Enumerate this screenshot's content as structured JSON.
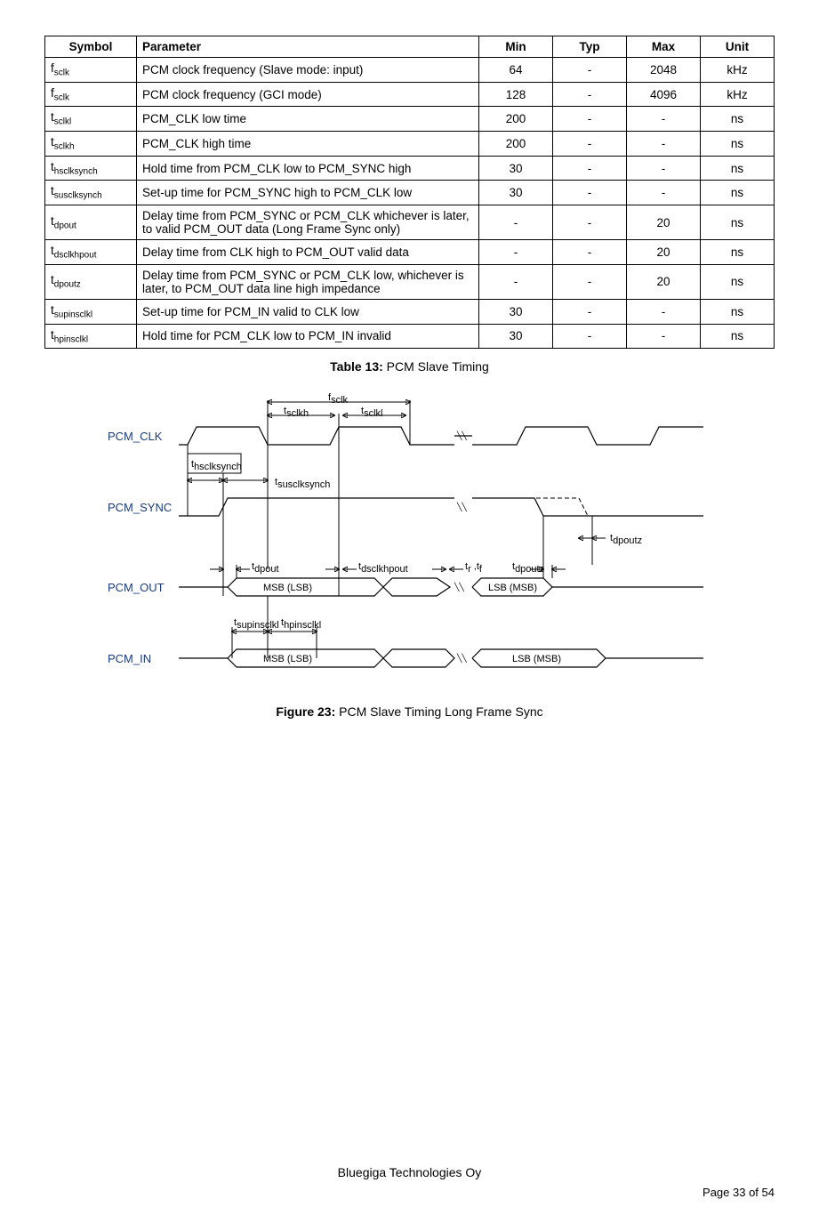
{
  "table": {
    "headers": [
      "Symbol",
      "Parameter",
      "Min",
      "Typ",
      "Max",
      "Unit"
    ],
    "caption_bold": "Table 13:",
    "caption_rest": " PCM Slave Timing",
    "rows": [
      {
        "sym_base": "f",
        "sym_sub": "sclk",
        "param": "PCM clock frequency (Slave mode: input)",
        "min": "64",
        "typ": "-",
        "max": "2048",
        "unit": "kHz"
      },
      {
        "sym_base": "f",
        "sym_sub": "sclk",
        "param": "PCM clock frequency (GCI mode)",
        "min": "128",
        "typ": "-",
        "max": "4096",
        "unit": "kHz"
      },
      {
        "sym_base": "t",
        "sym_sub": "sclkl",
        "param": "PCM_CLK low time",
        "min": "200",
        "typ": "-",
        "max": "-",
        "unit": "ns"
      },
      {
        "sym_base": "t",
        "sym_sub": "sclkh",
        "param": "PCM_CLK high time",
        "min": "200",
        "typ": "-",
        "max": "-",
        "unit": "ns"
      },
      {
        "sym_base": "t",
        "sym_sub": "hsclksynch",
        "param": "Hold time from PCM_CLK low to PCM_SYNC high",
        "min": "30",
        "typ": "-",
        "max": "-",
        "unit": "ns"
      },
      {
        "sym_base": "t",
        "sym_sub": "susclksynch",
        "param": "Set-up time for PCM_SYNC high to PCM_CLK low",
        "min": "30",
        "typ": "-",
        "max": "-",
        "unit": "ns"
      },
      {
        "sym_base": "t",
        "sym_sub": "dpout",
        "param": "Delay time from PCM_SYNC or PCM_CLK whichever is later, to valid PCM_OUT data (Long Frame Sync only)",
        "min": "-",
        "typ": "-",
        "max": "20",
        "unit": "ns"
      },
      {
        "sym_base": "t",
        "sym_sub": "dsclkhpout",
        "param": "Delay time from CLK high to PCM_OUT valid data",
        "min": "-",
        "typ": "-",
        "max": "20",
        "unit": "ns"
      },
      {
        "sym_base": "t",
        "sym_sub": "dpoutz",
        "param": "Delay time from PCM_SYNC or PCM_CLK low, whichever is later, to PCM_OUT data line high impedance",
        "min": "-",
        "typ": "-",
        "max": "20",
        "unit": "ns"
      },
      {
        "sym_base": "t",
        "sym_sub": "supinsclkl",
        "param": "Set-up time for PCM_IN valid to CLK low",
        "min": "30",
        "typ": "-",
        "max": "-",
        "unit": "ns"
      },
      {
        "sym_base": "t",
        "sym_sub": "hpinsclkl",
        "param": "Hold time for PCM_CLK low to PCM_IN invalid",
        "min": "30",
        "typ": "-",
        "max": "-",
        "unit": "ns"
      }
    ]
  },
  "figure": {
    "caption_bold": "Figure 23:",
    "caption_rest": " PCM Slave Timing Long Frame Sync",
    "signals": {
      "clk": "PCM_CLK",
      "sync": "PCM_SYNC",
      "out": "PCM_OUT",
      "in": "PCM_IN"
    },
    "labels": {
      "fsclk": "f",
      "fsclk_sub": "sclk",
      "tsclkh": "t",
      "tsclkh_sub": "sclkh",
      "tsclkl": "t",
      "tsclkl_sub": "sclkl",
      "thsclksynch": "t",
      "thsclksynch_sub": "hsclksynch",
      "tsusclksynch": "t",
      "tsusclksynch_sub": "susclksynch",
      "tdpout": "t",
      "tdpout_sub": "dpout",
      "tdsclkhpout": "t",
      "tdsclkhpout_sub": "dsclkhpout",
      "trtf": "t",
      "tr": "r",
      "tf": "f",
      "tdpoutz": "t",
      "tdpoutz_sub": "dpoutz",
      "tsupinsclkl": "t",
      "tsupinsclkl_sub": "supinsclkl",
      "thpinsclkl": "t",
      "thpinsclkl_sub": "hpinsclkl",
      "msb_lsb": "MSB (LSB)",
      "msb_lsb2": "MSB (LSB)",
      "lsb_msb": "LSB (MSB)",
      "lsb_msb2": "LSB (MSB)"
    }
  },
  "footer": "Bluegiga Technologies Oy",
  "pagenum": "Page 33 of 54"
}
